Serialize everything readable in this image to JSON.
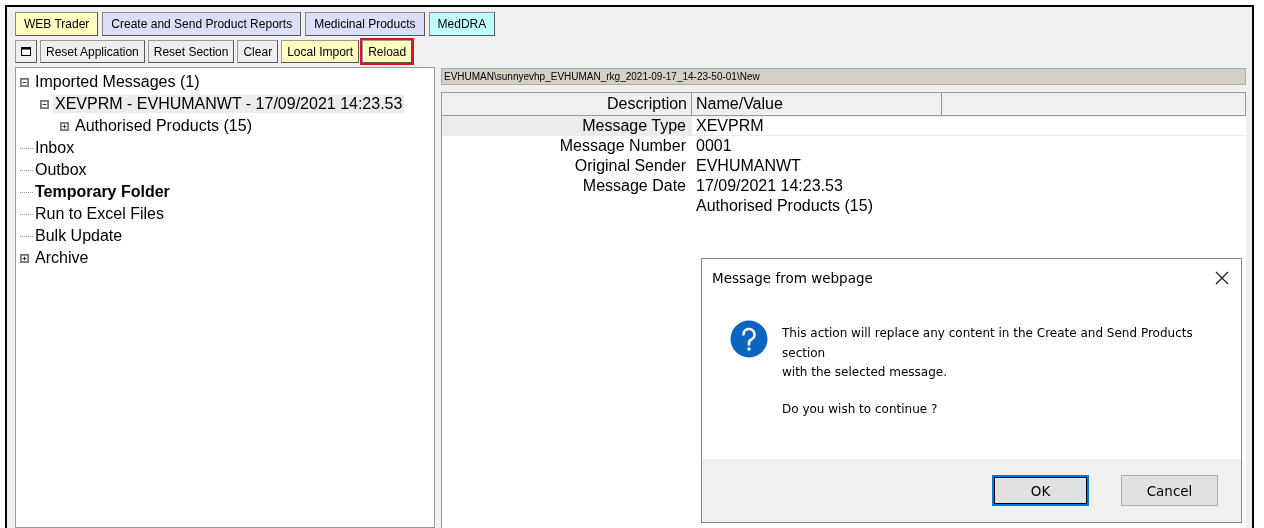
{
  "tabs": [
    {
      "label": "WEB Trader",
      "color": "#ffffc0"
    },
    {
      "label": "Create and Send Product Reports",
      "color": "#ddddfa"
    },
    {
      "label": "Medicinal Products",
      "color": "#ddddfa"
    },
    {
      "label": "MedDRA",
      "color": "#c0ffff"
    }
  ],
  "toolbar": [
    {
      "kind": "icon",
      "highlighted": false
    },
    {
      "kind": "text",
      "label": "Reset Application",
      "color": "#eeeeee",
      "highlighted": false
    },
    {
      "kind": "text",
      "label": "Reset Section",
      "color": "#eeeeee",
      "highlighted": false
    },
    {
      "kind": "text",
      "label": "Clear",
      "color": "#eeeeee",
      "highlighted": false
    },
    {
      "kind": "text",
      "label": "Local Import",
      "color": "#ffffc0",
      "highlighted": false
    },
    {
      "kind": "text",
      "label": "Reload",
      "color": "#ffffc0",
      "highlighted": true
    }
  ],
  "tree": [
    {
      "label": "Imported Messages (1)",
      "expanded": true,
      "selected": false,
      "bold": false,
      "children": [
        {
          "label": "XEVPRM - EVHUMANWT - 17/09/2021 14:23.53",
          "expanded": true,
          "selected": true,
          "bold": false,
          "children": [
            {
              "label": "Authorised Products (15)",
              "expanded": false,
              "selected": false,
              "bold": false
            }
          ]
        }
      ]
    },
    {
      "label": "Inbox",
      "selected": false,
      "bold": false
    },
    {
      "label": "Outbox",
      "selected": false,
      "bold": false
    },
    {
      "label": "Temporary Folder",
      "selected": false,
      "bold": true
    },
    {
      "label": "Run to Excel Files",
      "selected": false,
      "bold": false
    },
    {
      "label": "Bulk Update",
      "selected": false,
      "bold": false
    },
    {
      "label": "Archive",
      "expanded": false,
      "selected": false,
      "bold": false
    }
  ],
  "path": "EVHUMAN\\sunnyevhp_EVHUMAN_rkg_2021-09-17_14-23-50-01\\New",
  "table": {
    "columns": [
      "Description",
      "Name/Value"
    ],
    "rows": [
      {
        "description": "Message Type",
        "value": "XEVPRM",
        "selected": true
      },
      {
        "description": "Message Number",
        "value": "0001",
        "selected": false
      },
      {
        "description": "Original Sender",
        "value": "EVHUMANWT",
        "selected": false
      },
      {
        "description": "Message Date",
        "value": "17/09/2021 14:23.53",
        "selected": false
      },
      {
        "value": "Authorised Products (15)",
        "selected": false
      }
    ]
  },
  "dialog": {
    "title": "Message from webpage",
    "lines": [
      "This action will replace any content in the Create and Send Products section",
      "with the selected message."
    ],
    "question": "Do you wish to continue ?",
    "buttons": [
      {
        "label": "OK",
        "default": true
      },
      {
        "label": "Cancel",
        "default": false
      }
    ]
  }
}
